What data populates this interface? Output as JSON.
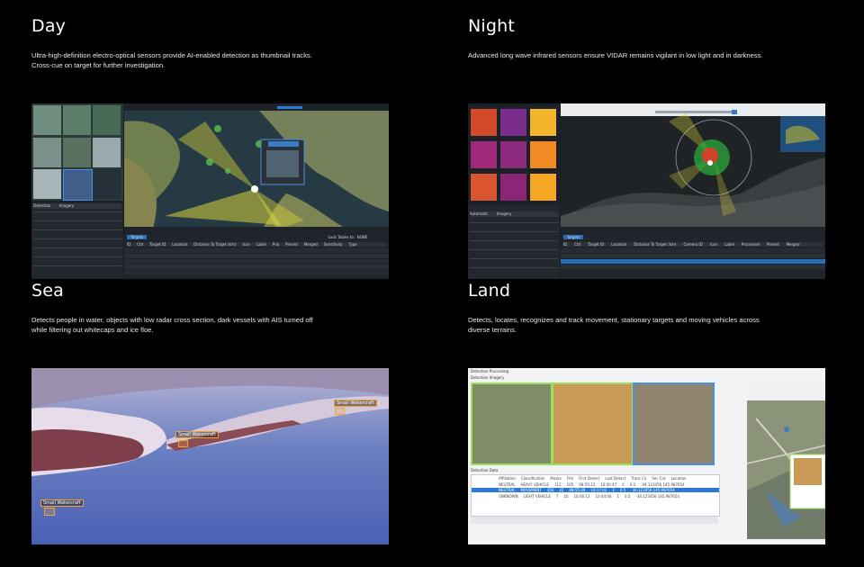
{
  "sections": {
    "day": {
      "title": "Day",
      "description": "Ultra-high-definition electro-optical sensors provide AI-enabled detection as thumbnail tracks. Cross-cue on target for further investigation.",
      "screenshot": {
        "targets_tab": "Targets",
        "lock_label": "Lock Tables to : NONE",
        "columns": [
          "ID",
          "Ctrl",
          "Target ID",
          "Location",
          "Distance To Target (km)",
          "Icon",
          "Label",
          "Prio",
          "Pinned",
          "Merged",
          "Sensitivity",
          "Type"
        ],
        "detail_tabs": [
          "Detection",
          "Imagery"
        ]
      }
    },
    "night": {
      "title": "Night",
      "description": "Advanced long wave infrared sensors ensure VIDAR remains vigilant in low light and in darkness.",
      "screenshot": {
        "targets_tab": "Targets",
        "detail_tabs": [
          "Automatic",
          "Imagery"
        ],
        "columns": [
          "ID",
          "Ctrl",
          "Target ID",
          "Location",
          "Distance To Target (km)",
          "Camera ID",
          "Icon",
          "Label",
          "Processed",
          "Pinned",
          "Merged"
        ]
      }
    },
    "sea": {
      "title": "Sea",
      "description": "Detects people in water, objects with low radar cross section, dark vessels with AIS turned off while filtering out whitecaps and ice floe.",
      "detections": [
        "Small Watercraft",
        "Small Watercraft",
        "Small Watercraft"
      ]
    },
    "land": {
      "title": "Land",
      "description": "Detects, locates, recognizes and track movement, stationary targets and moving vehicles across diverse terrains.",
      "screenshot": {
        "window_title": "Detection Processing",
        "imagery_label": "Detection Imagery",
        "summary_label": "Detection Data",
        "columns": [
          "Affiliation",
          "Classification",
          "Masks",
          "Frm",
          "First Detect",
          "Last Detect",
          "Track Co",
          "Sec Cnt",
          "Location"
        ],
        "rows": [
          [
            "NEUTRAL",
            "HEAVY VEHICLE",
            "112",
            "105",
            "08:55:13",
            "10:00:47",
            "2",
            "0.0",
            "-34.123456 145.987654"
          ],
          [
            "NEUTRAL",
            "MOVEMENT",
            "150",
            "22",
            "08:55:40",
            "10:17:02",
            "2",
            "0.5",
            "-34.123456 145.987654"
          ],
          [
            "UNKNOWN",
            "LIGHT VEHICLE",
            "7",
            "16",
            "10:06:13",
            "10:44:04",
            "1",
            "0.5",
            "-34.123456 145.987654"
          ]
        ]
      }
    }
  }
}
